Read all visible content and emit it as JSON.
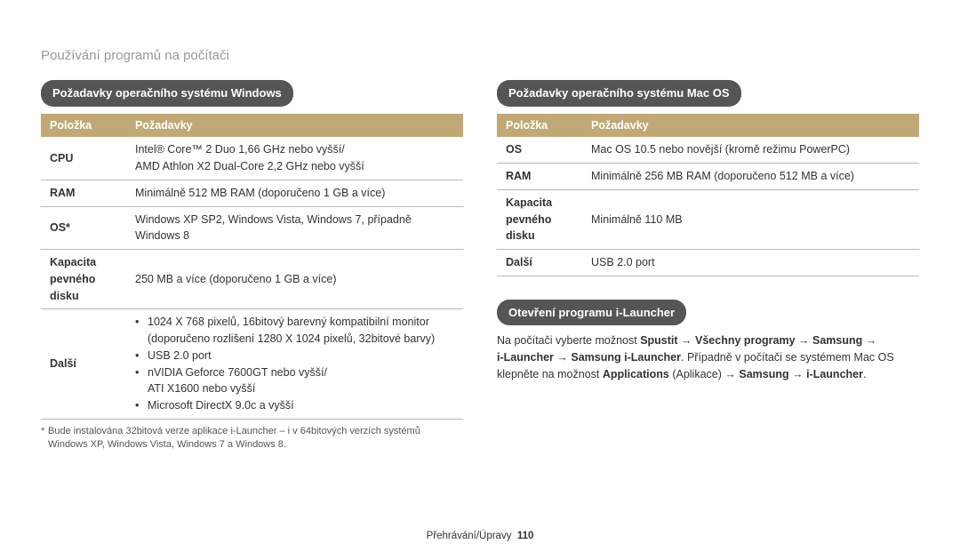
{
  "header": {
    "title": "Používání programů na počítači"
  },
  "windows": {
    "badge": "Požadavky operačního systému Windows",
    "headers": {
      "c1": "Položka",
      "c2": "Požadavky"
    },
    "rows": {
      "cpu": {
        "k": "CPU",
        "v1": "Intel® Core™ 2 Duo 1,66 GHz nebo vyšší/",
        "v2": "AMD Athlon X2 Dual-Core 2,2 GHz nebo vyšší"
      },
      "ram": {
        "k": "RAM",
        "v": "Minimálně 512 MB RAM (doporučeno 1 GB a více)"
      },
      "os": {
        "k": "OS*",
        "v": "Windows XP SP2, Windows Vista, Windows 7, případně Windows 8"
      },
      "hdd": {
        "k1": "Kapacita",
        "k2": "pevného",
        "k3": "disku",
        "v": "250 MB a více (doporučeno 1 GB a více)"
      },
      "other": {
        "k": "Další",
        "b1a": "1024 X 768 pixelů, 16bitový barevný kompatibilní monitor",
        "b1b": "(doporučeno rozlišení 1280 X 1024 pixelů, 32bitové barvy)",
        "b2": "USB 2.0 port",
        "b3a": "nVIDIA Geforce 7600GT nebo vyšší/",
        "b3b": "ATI X1600 nebo vyšší",
        "b4": "Microsoft DirectX 9.0c a vyšší"
      }
    },
    "footnote1": "Bude instalována 32bitová verze aplikace i-Launcher – i v 64bitových verzích systémů",
    "footnote2": "Windows XP, Windows Vista, Windows 7 a Windows 8."
  },
  "mac": {
    "badge": "Požadavky operačního systému Mac OS",
    "headers": {
      "c1": "Položka",
      "c2": "Požadavky"
    },
    "rows": {
      "os": {
        "k": "OS",
        "v": "Mac OS 10.5 nebo novější (kromě režimu PowerPC)"
      },
      "ram": {
        "k": "RAM",
        "v": "Minimálně 256 MB RAM (doporučeno 512 MB a více)"
      },
      "hdd": {
        "k1": "Kapacita",
        "k2": "pevného",
        "k3": "disku",
        "v": "Minimálně 110 MB"
      },
      "other": {
        "k": "Další",
        "v": "USB 2.0 port"
      }
    }
  },
  "launcher": {
    "badge": "Otevření programu i-Launcher",
    "t1": "Na počítači vyberte možnost ",
    "b1": "Spustit",
    "arrow": " → ",
    "b2": "Všechny programy",
    "b3": "Samsung",
    "b4": "i-Launcher",
    "b5": "Samsung i-Launcher",
    "t2": ". Případně v počítači se systémem Mac OS",
    "t3": "klepněte na možnost ",
    "b6": "Applications",
    "t4": " (Aplikace) "
  },
  "footer": {
    "section": "Přehrávání/Úpravy",
    "page": "110"
  }
}
